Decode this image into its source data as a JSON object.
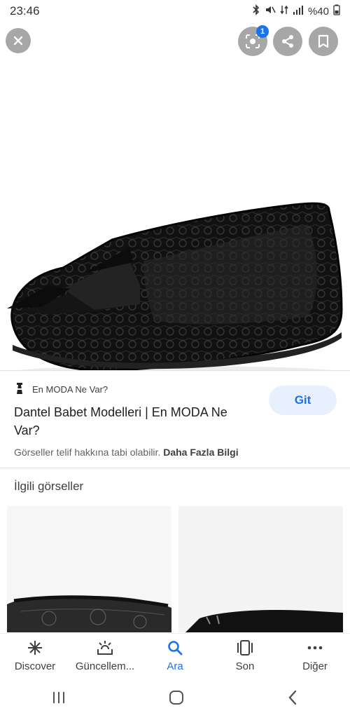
{
  "status": {
    "time": "23:46",
    "battery": "%40"
  },
  "hero": {
    "lens_badge": "1"
  },
  "result": {
    "source": "En MODA Ne Var?",
    "title": "Dantel Babet Modelleri | En MODA Ne Var?",
    "visit_label": "Git",
    "copyright_text": "Görseller telif hakkına tabi olabilir.",
    "more_info": "Daha Fazla Bilgi"
  },
  "related": {
    "heading": "İlgili görseller"
  },
  "bottom_nav": {
    "items": [
      {
        "label": "Discover",
        "icon": "asterisk-icon"
      },
      {
        "label": "Güncellem...",
        "icon": "updates-icon"
      },
      {
        "label": "Ara",
        "icon": "search-icon"
      },
      {
        "label": "Son",
        "icon": "recent-tabs-icon"
      },
      {
        "label": "Diğer",
        "icon": "more-icon"
      }
    ],
    "active_color": "#1a73e8"
  }
}
